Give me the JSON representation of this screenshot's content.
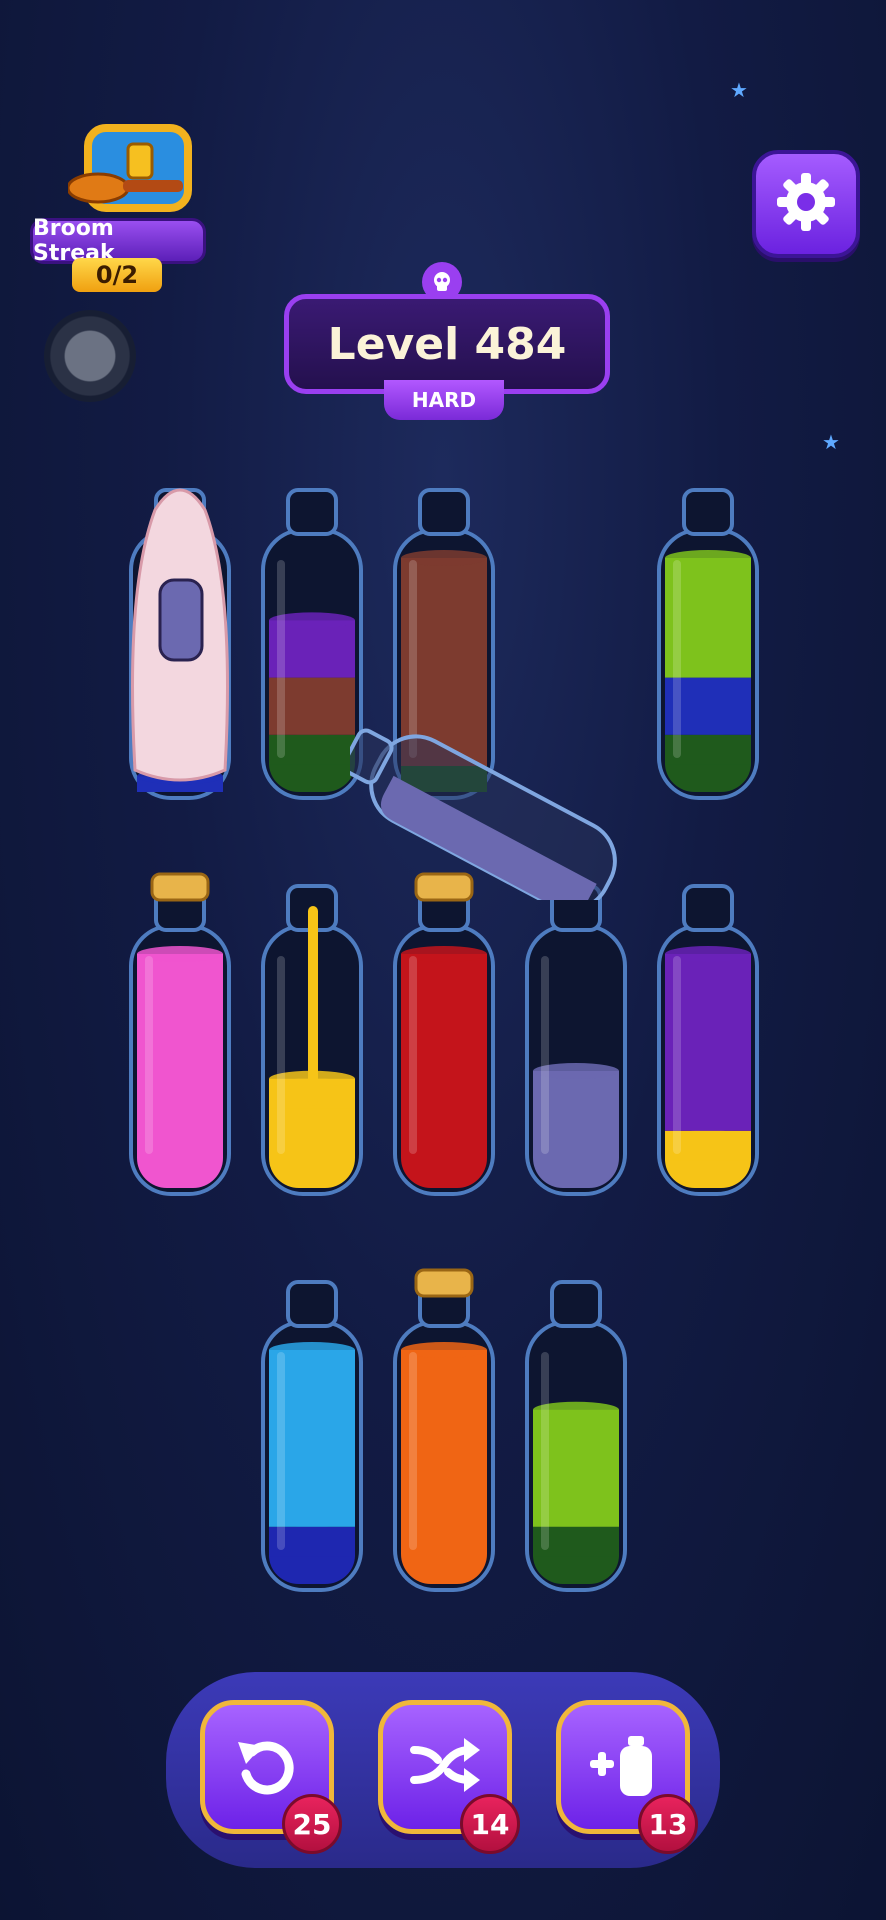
{
  "streak": {
    "label": "Broom Streak",
    "count": "0/2"
  },
  "level": {
    "title": "Level 484",
    "difficulty": "HARD"
  },
  "colors": {
    "purple": "#6a22b8",
    "brown": "#7d3b2f",
    "darkgreen": "#1f5a1c",
    "lime": "#7ec21c",
    "blue": "#1f2fb8",
    "pink": "#f055cf",
    "yellow": "#f6c417",
    "red": "#c4141b",
    "slate": "#6b69b0",
    "cyan": "#2aa6e8",
    "orange": "#f06514",
    "navy": "#1e27b0"
  },
  "tubes": [
    {
      "name": "tube-1-covered",
      "layers": [
        {
          "color": "blue",
          "frac": 0.06
        }
      ],
      "cap": false,
      "covered": true
    },
    {
      "name": "tube-2",
      "layers": [
        {
          "color": "darkgreen",
          "frac": 0.22
        },
        {
          "color": "brown",
          "frac": 0.22
        },
        {
          "color": "purple",
          "frac": 0.22
        }
      ],
      "cap": false
    },
    {
      "name": "tube-3",
      "layers": [
        {
          "color": "darkgreen",
          "frac": 0.1
        },
        {
          "color": "brown",
          "frac": 0.8
        }
      ],
      "cap": false
    },
    {
      "name": "tube-4",
      "layers": [
        {
          "color": "darkgreen",
          "frac": 0.22
        },
        {
          "color": "blue",
          "frac": 0.22
        },
        {
          "color": "lime",
          "frac": 0.46
        }
      ],
      "cap": false
    },
    {
      "name": "tube-5",
      "layers": [
        {
          "color": "pink",
          "frac": 0.9
        }
      ],
      "cap": true
    },
    {
      "name": "tube-6",
      "layers": [
        {
          "color": "yellow",
          "frac": 0.42
        }
      ],
      "cap": false,
      "pouring": true
    },
    {
      "name": "tube-7",
      "layers": [
        {
          "color": "red",
          "frac": 0.9
        }
      ],
      "cap": true
    },
    {
      "name": "tube-8",
      "layers": [
        {
          "color": "slate",
          "frac": 0.45
        }
      ],
      "cap": false
    },
    {
      "name": "tube-9",
      "layers": [
        {
          "color": "yellow",
          "frac": 0.22
        },
        {
          "color": "purple",
          "frac": 0.68
        }
      ],
      "cap": false
    },
    {
      "name": "tube-10",
      "layers": [
        {
          "color": "navy",
          "frac": 0.22
        },
        {
          "color": "cyan",
          "frac": 0.68
        }
      ],
      "cap": false
    },
    {
      "name": "tube-11",
      "layers": [
        {
          "color": "orange",
          "frac": 0.9
        }
      ],
      "cap": true
    },
    {
      "name": "tube-12",
      "layers": [
        {
          "color": "darkgreen",
          "frac": 0.22
        },
        {
          "color": "lime",
          "frac": 0.45
        }
      ],
      "cap": false
    }
  ],
  "tools": [
    {
      "name": "undo",
      "count": "25",
      "icon": "undo-icon"
    },
    {
      "name": "shuffle",
      "count": "14",
      "icon": "shuffle-icon"
    },
    {
      "name": "add-tube",
      "count": "13",
      "icon": "add-bottle-icon"
    }
  ]
}
